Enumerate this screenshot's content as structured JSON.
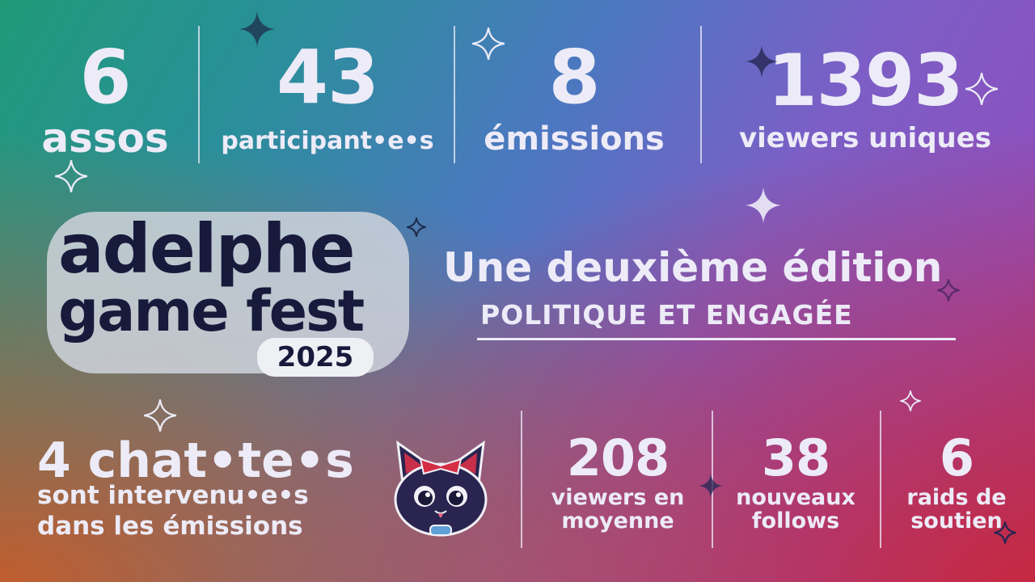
{
  "top_stats": [
    {
      "value": "6",
      "label": "assos"
    },
    {
      "value": "43",
      "label": "participant•e•s"
    },
    {
      "value": "8",
      "label": "émissions"
    },
    {
      "value": "1393",
      "label": "viewers uniques"
    }
  ],
  "logo": {
    "line1": "adelphe",
    "line2": "game fest",
    "year": "2025"
  },
  "tagline": {
    "line1": "Une deuxième édition",
    "line2": "POLITIQUE ET ENGAGÉE"
  },
  "chatte_block": {
    "value": "4 chat•te•s",
    "line1": "sont intervenu•e•s",
    "line2": "dans les émissions"
  },
  "bottom_stats": [
    {
      "value": "208",
      "line1": "viewers en",
      "line2": "moyenne"
    },
    {
      "value": "38",
      "line1": "nouveaux",
      "line2": "follows"
    },
    {
      "value": "6",
      "line1": "raids de",
      "line2": "soutien"
    }
  ],
  "colors": {
    "text": "#ecebf7",
    "logo_dark": "#181a3c",
    "logo_bg": "#cfd3dc"
  },
  "icons": [
    "sparkle-icon",
    "cat-mascot-icon"
  ]
}
